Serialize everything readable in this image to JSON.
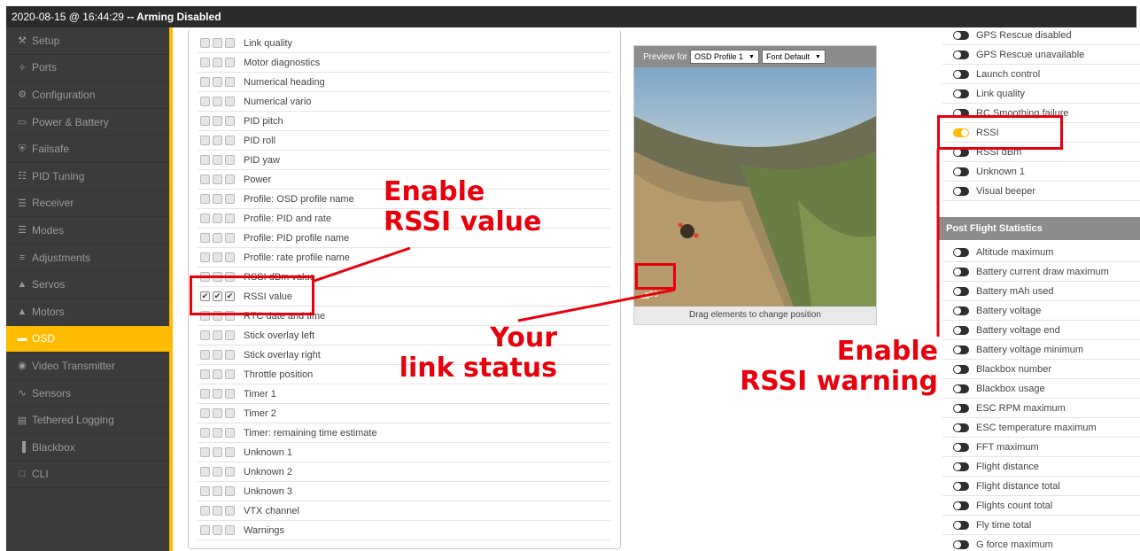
{
  "window": {
    "date": "2020-08-15 @ 16:44:29",
    "status": " -- Arming Disabled"
  },
  "sidebar": {
    "items": [
      {
        "label": "Setup",
        "icon": "wrench-icon",
        "glyph": "⚒"
      },
      {
        "label": "Ports",
        "icon": "plug-icon",
        "glyph": "✧"
      },
      {
        "label": "Configuration",
        "icon": "gear-icon",
        "glyph": "⚙"
      },
      {
        "label": "Power & Battery",
        "icon": "battery-icon",
        "glyph": "▭"
      },
      {
        "label": "Failsafe",
        "icon": "shield-icon",
        "glyph": "⛨"
      },
      {
        "label": "PID Tuning",
        "icon": "tuning-icon",
        "glyph": "☷"
      },
      {
        "label": "Receiver",
        "icon": "receiver-icon",
        "glyph": "☰"
      },
      {
        "label": "Modes",
        "icon": "modes-icon",
        "glyph": "☰"
      },
      {
        "label": "Adjustments",
        "icon": "sliders-icon",
        "glyph": "≡"
      },
      {
        "label": "Servos",
        "icon": "servo-icon",
        "glyph": "▲"
      },
      {
        "label": "Motors",
        "icon": "motor-icon",
        "glyph": "▲"
      },
      {
        "label": "OSD",
        "icon": "osd-icon",
        "glyph": "▬"
      },
      {
        "label": "Video Transmitter",
        "icon": "antenna-icon",
        "glyph": "◉"
      },
      {
        "label": "Sensors",
        "icon": "sensor-icon",
        "glyph": "∿"
      },
      {
        "label": "Tethered Logging",
        "icon": "log-icon",
        "glyph": "▤"
      },
      {
        "label": "Blackbox",
        "icon": "blackbox-icon",
        "glyph": "▐"
      },
      {
        "label": "CLI",
        "icon": "terminal-icon",
        "glyph": "□"
      }
    ],
    "active_index": 11,
    "accent_color": "#ffbb00"
  },
  "elements": {
    "items": [
      {
        "label": "Link quality",
        "checked": false
      },
      {
        "label": "Motor diagnostics",
        "checked": false
      },
      {
        "label": "Numerical heading",
        "checked": false
      },
      {
        "label": "Numerical vario",
        "checked": false
      },
      {
        "label": "PID pitch",
        "checked": false
      },
      {
        "label": "PID roll",
        "checked": false
      },
      {
        "label": "PID yaw",
        "checked": false
      },
      {
        "label": "Power",
        "checked": false
      },
      {
        "label": "Profile: OSD profile name",
        "checked": false
      },
      {
        "label": "Profile: PID and rate",
        "checked": false
      },
      {
        "label": "Profile: PID profile name",
        "checked": false
      },
      {
        "label": "Profile: rate profile name",
        "checked": false
      },
      {
        "label": "RSSI dBm value",
        "checked": false
      },
      {
        "label": "RSSI value",
        "checked": true
      },
      {
        "label": "RTC date and time",
        "checked": false
      },
      {
        "label": "Stick overlay left",
        "checked": false
      },
      {
        "label": "Stick overlay right",
        "checked": false
      },
      {
        "label": "Throttle position",
        "checked": false
      },
      {
        "label": "Timer 1",
        "checked": false
      },
      {
        "label": "Timer 2",
        "checked": false
      },
      {
        "label": "Timer: remaining time estimate",
        "checked": false
      },
      {
        "label": "Unknown 1",
        "checked": false
      },
      {
        "label": "Unknown 2",
        "checked": false
      },
      {
        "label": "Unknown 3",
        "checked": false
      },
      {
        "label": "VTX channel",
        "checked": false
      },
      {
        "label": "Warnings",
        "checked": false
      }
    ]
  },
  "preview": {
    "label": "Preview for",
    "profile": "OSD Profile 1",
    "font": "Font Default",
    "rssi_readout": "99",
    "footer": "Drag elements to change position"
  },
  "warnings": {
    "items": [
      {
        "label": "GPS Rescue disabled",
        "on": false
      },
      {
        "label": "GPS Rescue unavailable",
        "on": false
      },
      {
        "label": "Launch control",
        "on": false
      },
      {
        "label": "Link quality",
        "on": false
      },
      {
        "label": "RC Smoothing failure",
        "on": false
      },
      {
        "label": "RSSI",
        "on": true
      },
      {
        "label": "RSSI dBm",
        "on": false
      },
      {
        "label": "Unknown 1",
        "on": false
      },
      {
        "label": "Visual beeper",
        "on": false
      }
    ]
  },
  "stats": {
    "header": "Post Flight Statistics",
    "items": [
      {
        "label": "Altitude maximum",
        "on": false
      },
      {
        "label": "Battery current draw maximum",
        "on": false
      },
      {
        "label": "Battery mAh used",
        "on": false
      },
      {
        "label": "Battery voltage",
        "on": false
      },
      {
        "label": "Battery voltage end",
        "on": false
      },
      {
        "label": "Battery voltage minimum",
        "on": false
      },
      {
        "label": "Blackbox number",
        "on": false
      },
      {
        "label": "Blackbox usage",
        "on": false
      },
      {
        "label": "ESC RPM maximum",
        "on": false
      },
      {
        "label": "ESC temperature maximum",
        "on": false
      },
      {
        "label": "FFT maximum",
        "on": false
      },
      {
        "label": "Flight distance",
        "on": false
      },
      {
        "label": "Flight distance total",
        "on": false
      },
      {
        "label": "Flights count total",
        "on": false
      },
      {
        "label": "Fly time total",
        "on": false
      },
      {
        "label": "G force maximum",
        "on": false
      }
    ]
  },
  "annotations": {
    "enable_value_line1": "Enable",
    "enable_value_line2": "RSSI value",
    "link_line1": "Your",
    "link_line2": "link status",
    "warning_line1": "Enable",
    "warning_line2": "RSSI warning",
    "color": "#e8000c"
  }
}
